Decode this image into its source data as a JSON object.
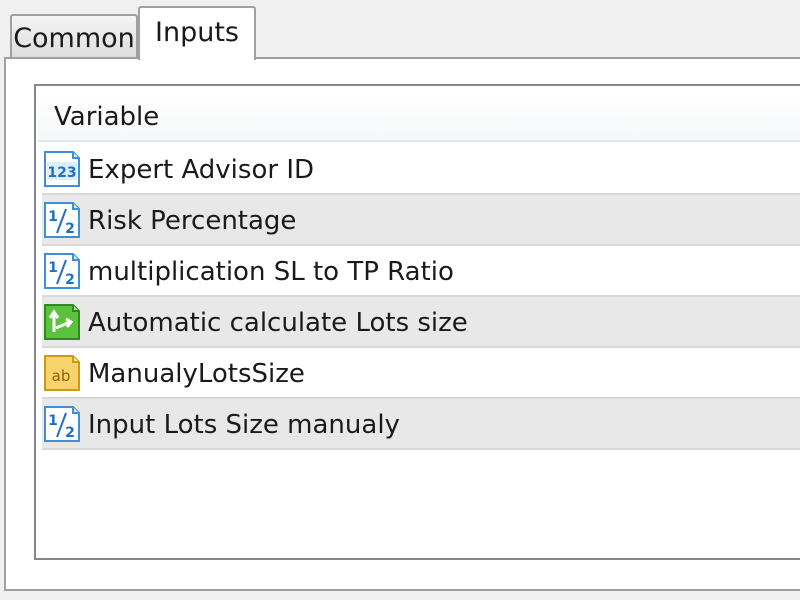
{
  "tabs": [
    {
      "label": "Common",
      "active": false
    },
    {
      "label": "Inputs",
      "active": true
    }
  ],
  "table": {
    "header": "Variable",
    "rows": [
      {
        "icon": "integer-123-icon",
        "label": "Expert Advisor ID"
      },
      {
        "icon": "fraction-half-icon",
        "label": "Risk Percentage"
      },
      {
        "icon": "fraction-half-icon",
        "label": "multiplication SL to TP Ratio"
      },
      {
        "icon": "boolean-arrow-icon",
        "label": "Automatic calculate Lots size"
      },
      {
        "icon": "string-ab-icon",
        "label": "ManualyLotsSize"
      },
      {
        "icon": "fraction-half-icon",
        "label": "Input Lots Size manualy"
      }
    ]
  },
  "colors": {
    "number_icon": "#3f8fd6",
    "bool_icon": "#3aa02a",
    "string_icon": "#e0b02a",
    "alt_row": "#e8e8e8"
  }
}
